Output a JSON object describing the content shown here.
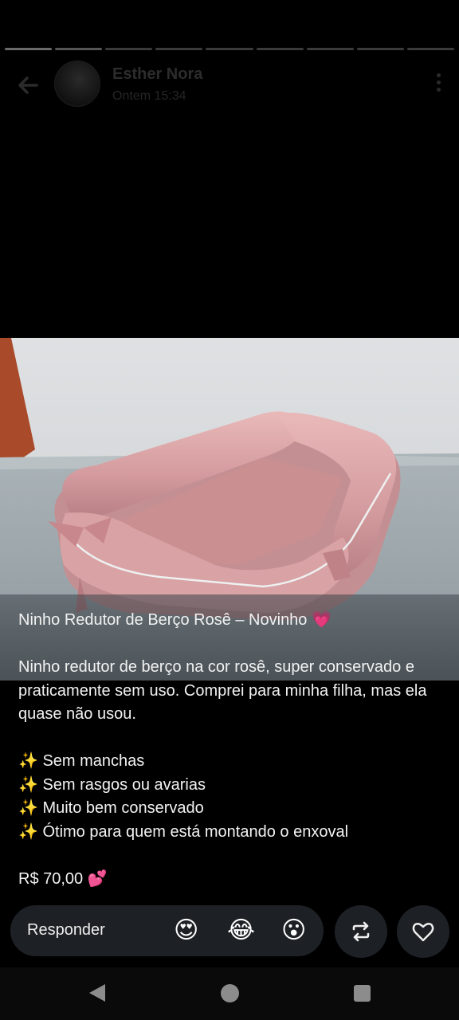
{
  "story": {
    "progress_segments": 9,
    "active_segment": 2
  },
  "header": {
    "name": "Esther Nora",
    "timestamp": "Ontem 15:34",
    "back_icon": "arrow-left-icon",
    "menu_icon": "more-vertical-icon"
  },
  "caption": {
    "title": "Ninho Redutor de Berço Rosê – Novinho 💗",
    "description": "Ninho redutor de berço na cor rosê, super conservado e praticamente sem uso. Comprei para minha filha, mas ela quase não usou.",
    "bullets": [
      "✨ Sem manchas",
      "✨ Sem rasgos ou avarias",
      "✨ Muito bem conservado",
      "✨ Ótimo para quem está montando o enxoval"
    ],
    "price": "R$ 70,00 💕"
  },
  "reply_bar": {
    "placeholder": "Responder",
    "reactions": [
      "😍",
      "😂",
      "😮"
    ],
    "forward_icon": "repost-icon",
    "like_icon": "heart-icon"
  },
  "colors": {
    "background": "#000000",
    "product_pink": "#d8a0a2"
  }
}
